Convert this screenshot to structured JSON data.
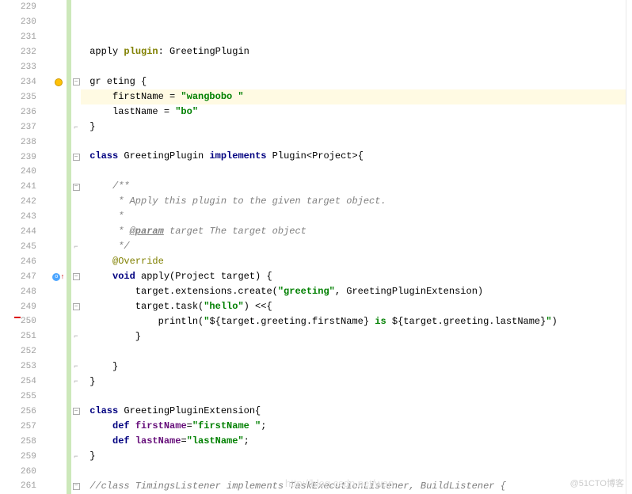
{
  "lines": [
    {
      "n": 229,
      "fold": "",
      "icon": "",
      "code": []
    },
    {
      "n": 230,
      "fold": "",
      "icon": "",
      "code": []
    },
    {
      "n": 231,
      "fold": "",
      "icon": "",
      "code": []
    },
    {
      "n": 232,
      "fold": "",
      "icon": "",
      "code": [
        {
          "t": " apply ",
          "c": ""
        },
        {
          "t": "plugin",
          "c": "kw-olive"
        },
        {
          "t": ": GreetingPlugin",
          "c": ""
        }
      ]
    },
    {
      "n": 233,
      "fold": "",
      "icon": "",
      "code": []
    },
    {
      "n": 234,
      "fold": "-",
      "icon": "bulb",
      "code": [
        {
          "t": " gr eting {",
          "c": ""
        }
      ]
    },
    {
      "n": 235,
      "fold": "",
      "icon": "",
      "hl": true,
      "code": [
        {
          "t": "     firstName = ",
          "c": ""
        },
        {
          "t": "\"wangbobo \"",
          "c": "str"
        }
      ]
    },
    {
      "n": 236,
      "fold": "",
      "icon": "",
      "code": [
        {
          "t": "     lastName = ",
          "c": ""
        },
        {
          "t": "\"bo\"",
          "c": "str"
        }
      ]
    },
    {
      "n": 237,
      "fold": "e",
      "icon": "",
      "code": [
        {
          "t": " }",
          "c": ""
        }
      ]
    },
    {
      "n": 238,
      "fold": "",
      "icon": "",
      "code": []
    },
    {
      "n": 239,
      "fold": "-",
      "icon": "",
      "code": [
        {
          "t": " ",
          "c": ""
        },
        {
          "t": "class ",
          "c": "kw-class"
        },
        {
          "t": "GreetingPlugin ",
          "c": ""
        },
        {
          "t": "implements ",
          "c": "kw-implements"
        },
        {
          "t": "Plugin<Project>{",
          "c": ""
        }
      ]
    },
    {
      "n": 240,
      "fold": "",
      "icon": "",
      "code": []
    },
    {
      "n": 241,
      "fold": "-",
      "icon": "",
      "code": [
        {
          "t": "     /**",
          "c": "comment"
        }
      ]
    },
    {
      "n": 242,
      "fold": "",
      "icon": "",
      "code": [
        {
          "t": "      * Apply this plugin to the given target object.",
          "c": "comment"
        }
      ]
    },
    {
      "n": 243,
      "fold": "",
      "icon": "",
      "code": [
        {
          "t": "      *",
          "c": "comment"
        }
      ]
    },
    {
      "n": 244,
      "fold": "",
      "icon": "",
      "code": [
        {
          "t": "      * ",
          "c": "comment"
        },
        {
          "t": "@param",
          "c": "comment-tag"
        },
        {
          "t": " target The target object",
          "c": "comment"
        }
      ]
    },
    {
      "n": 245,
      "fold": "e",
      "icon": "",
      "code": [
        {
          "t": "      */",
          "c": "comment"
        }
      ]
    },
    {
      "n": 246,
      "fold": "",
      "icon": "",
      "code": [
        {
          "t": "     ",
          "c": ""
        },
        {
          "t": "@Override",
          "c": "anno"
        }
      ]
    },
    {
      "n": 247,
      "fold": "-",
      "icon": "override",
      "code": [
        {
          "t": "     ",
          "c": ""
        },
        {
          "t": "void ",
          "c": "kw-void"
        },
        {
          "t": "apply(Project target) {",
          "c": ""
        }
      ]
    },
    {
      "n": 248,
      "fold": "",
      "icon": "",
      "code": [
        {
          "t": "         target.extensions.create(",
          "c": ""
        },
        {
          "t": "\"greeting\"",
          "c": "str"
        },
        {
          "t": ", GreetingPluginExtension)",
          "c": ""
        }
      ]
    },
    {
      "n": 249,
      "fold": "-",
      "icon": "",
      "code": [
        {
          "t": "         target.task(",
          "c": ""
        },
        {
          "t": "\"hello\"",
          "c": "str"
        },
        {
          "t": ") <<{",
          "c": ""
        }
      ]
    },
    {
      "n": 250,
      "fold": "",
      "icon": "",
      "code": [
        {
          "t": "             println(",
          "c": ""
        },
        {
          "t": "\"",
          "c": "str"
        },
        {
          "t": "${target.greeting.firstName}",
          "c": ""
        },
        {
          "t": " is ",
          "c": "str"
        },
        {
          "t": "${target.greeting.lastName}",
          "c": ""
        },
        {
          "t": "\"",
          "c": "str"
        },
        {
          "t": ")",
          "c": ""
        }
      ]
    },
    {
      "n": 251,
      "fold": "e",
      "icon": "",
      "code": [
        {
          "t": "         }",
          "c": ""
        }
      ]
    },
    {
      "n": 252,
      "fold": "",
      "icon": "",
      "code": []
    },
    {
      "n": 253,
      "fold": "e",
      "icon": "",
      "code": [
        {
          "t": "     }",
          "c": ""
        }
      ]
    },
    {
      "n": 254,
      "fold": "e",
      "icon": "",
      "code": [
        {
          "t": " }",
          "c": ""
        }
      ]
    },
    {
      "n": 255,
      "fold": "",
      "icon": "",
      "code": []
    },
    {
      "n": 256,
      "fold": "-",
      "icon": "",
      "code": [
        {
          "t": " ",
          "c": ""
        },
        {
          "t": "class ",
          "c": "kw-class"
        },
        {
          "t": "GreetingPluginExtension{",
          "c": ""
        }
      ]
    },
    {
      "n": 257,
      "fold": "",
      "icon": "",
      "code": [
        {
          "t": "     ",
          "c": ""
        },
        {
          "t": "def ",
          "c": "kw-def"
        },
        {
          "t": "firstName",
          "c": "ident-olive"
        },
        {
          "t": "=",
          "c": ""
        },
        {
          "t": "\"firstName \"",
          "c": "str"
        },
        {
          "t": ";",
          "c": ""
        }
      ]
    },
    {
      "n": 258,
      "fold": "",
      "icon": "",
      "code": [
        {
          "t": "     ",
          "c": ""
        },
        {
          "t": "def ",
          "c": "kw-def"
        },
        {
          "t": "lastName",
          "c": "ident-olive"
        },
        {
          "t": "=",
          "c": ""
        },
        {
          "t": "\"lastName\"",
          "c": "str"
        },
        {
          "t": ";",
          "c": ""
        }
      ]
    },
    {
      "n": 259,
      "fold": "e",
      "icon": "",
      "code": [
        {
          "t": " }",
          "c": ""
        }
      ]
    },
    {
      "n": 260,
      "fold": "",
      "icon": "",
      "code": []
    },
    {
      "n": 261,
      "fold": "-",
      "icon": "",
      "code": [
        {
          "t": " //class TimingsListener implements TaskExecutionListener, BuildListener {",
          "c": "comment"
        }
      ]
    }
  ],
  "watermark_main": "@51CTO博客",
  "watermark_faint": "http://blog.csdn.net/wan"
}
